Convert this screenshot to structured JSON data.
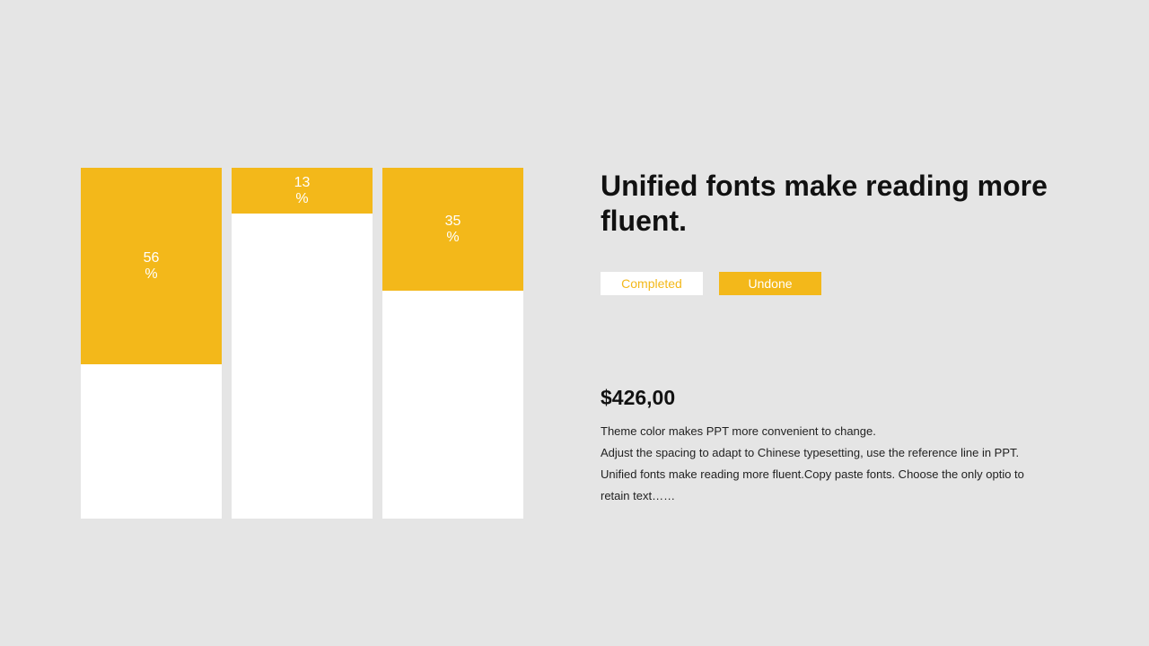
{
  "chart_data": {
    "type": "bar",
    "categories": [
      "",
      "",
      ""
    ],
    "values": [
      56,
      13,
      35
    ],
    "labels": [
      "56\n%",
      "13\n%",
      "35\n%"
    ],
    "ylim": [
      0,
      100
    ],
    "colors": {
      "fill": "#f3b81a",
      "track": "#ffffff"
    }
  },
  "title": "Unified fonts make reading more fluent.",
  "legend": {
    "completed": "Completed",
    "undone": "Undone"
  },
  "price": "$426,00",
  "description": "Theme  color makes PPT more convenient to change.\nAdjust the spacing to adapt to Chinese typesetting, use the reference line in PPT.\nUnified fonts make reading more fluent.Copy paste fonts. Choose the only optio to retain text……"
}
